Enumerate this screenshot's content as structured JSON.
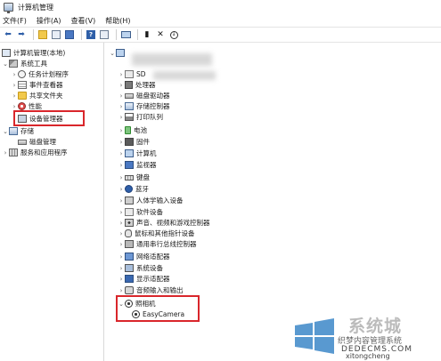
{
  "window": {
    "title": "计算机管理"
  },
  "menu": [
    "文件(F)",
    "操作(A)",
    "查看(V)",
    "帮助(H)"
  ],
  "toolbar": {
    "icons": [
      "back-arrow-icon",
      "forward-arrow-icon",
      "folder-up-icon",
      "properties-icon",
      "list-view-icon",
      "help-icon",
      "details-icon",
      "monitor-icon",
      "enable-device-icon",
      "remove-device-icon",
      "download-icon"
    ]
  },
  "tree": {
    "root": "计算机管理(本地)",
    "system_tools": "系统工具",
    "task_scheduler": "任务计划程序",
    "event_viewer": "事件查看器",
    "shared_folders": "共享文件夹",
    "performance": "性能",
    "device_manager": "设备管理器",
    "storage": "存储",
    "disk_management": "磁盘管理",
    "services_apps": "服务和应用程序"
  },
  "devices": {
    "computer_name": "",
    "categories": [
      "SD",
      "处理器",
      "磁盘驱动器",
      "存储控制器",
      "打印队列",
      "电池",
      "固件",
      "计算机",
      "监视器",
      "键盘",
      "蓝牙",
      "人体学输入设备",
      "软件设备",
      "声音、视频和游戏控制器",
      "鼠标和其他指针设备",
      "通用串行总线控制器",
      "网络适配器",
      "系统设备",
      "显示适配器",
      "音频输入和输出"
    ],
    "camera_group": "照相机",
    "camera_device": "EasyCamera"
  },
  "watermark": {
    "main": "系统城",
    "site": "织梦内容管理系统",
    "url": "DEDECMS.COM",
    "sub": "xitongcheng"
  },
  "colors": {
    "highlight": "#d9262b",
    "folder": "#f2c94c",
    "accent": "#2f5fa8"
  }
}
